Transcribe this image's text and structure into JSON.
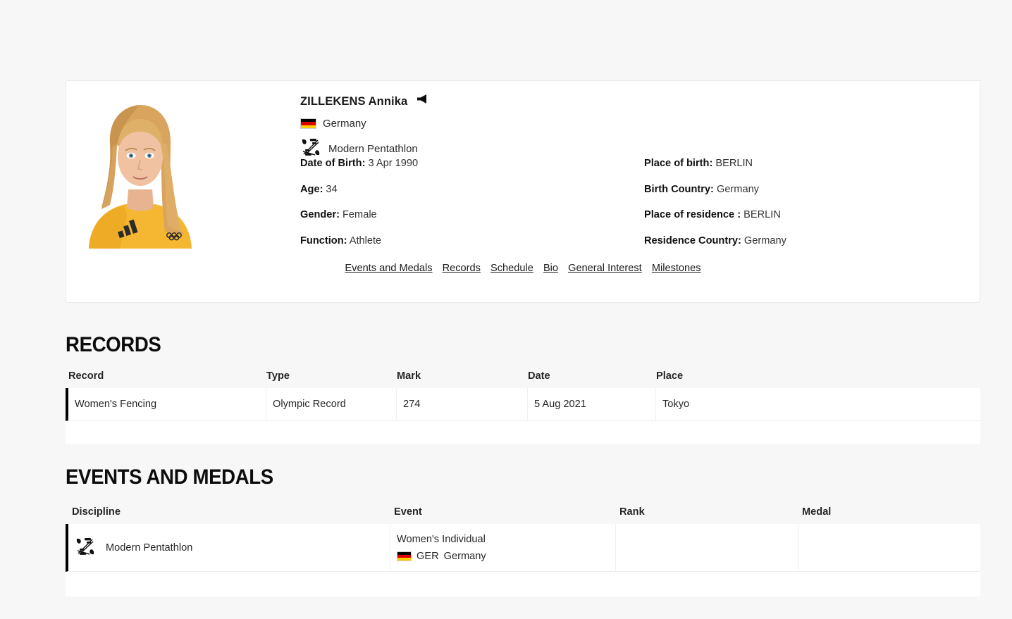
{
  "athlete": {
    "name": "ZILLEKENS Annika",
    "audio_icon": "speaker-icon",
    "country": "Germany",
    "country_flag": "germany-flag-icon",
    "sport": "Modern Pentathlon",
    "sport_icon": "modern-pentathlon-icon",
    "photo_alt": "athlete-portrait",
    "details_left": [
      {
        "label": "Date of Birth:",
        "value": "3 Apr 1990"
      },
      {
        "label": "Age:",
        "value": "34"
      },
      {
        "label": "Gender:",
        "value": "Female"
      },
      {
        "label": "Function:",
        "value": "Athlete"
      }
    ],
    "details_right": [
      {
        "label": "Place of birth:",
        "value": "BERLIN"
      },
      {
        "label": "Birth Country:",
        "value": "Germany"
      },
      {
        "label": "Place of residence :",
        "value": "BERLIN"
      },
      {
        "label": "Residence Country:",
        "value": "Germany"
      }
    ],
    "nav_links": [
      "Events and Medals",
      "Records",
      "Schedule",
      "Bio",
      "General Interest",
      "Milestones"
    ]
  },
  "records_section": {
    "title": "RECORDS",
    "columns": [
      "Record",
      "Type",
      "Mark",
      "Date",
      "Place"
    ],
    "rows": [
      {
        "record": "Women's Fencing",
        "type": "Olympic Record",
        "mark": "274",
        "date": "5 Aug 2021",
        "place": "Tokyo"
      }
    ]
  },
  "events_section": {
    "title": "EVENTS AND MEDALS",
    "columns": [
      "Discipline",
      "Event",
      "Rank",
      "Medal"
    ],
    "rows": [
      {
        "discipline": "Modern Pentathlon",
        "discipline_icon": "modern-pentathlon-icon",
        "event_name": "Women's Individual",
        "event_country_code": "GER",
        "event_country": "Germany",
        "event_country_flag": "germany-flag-icon",
        "rank": "",
        "medal": ""
      }
    ]
  },
  "colors": {
    "page_background": "#f7f7f7",
    "card_background": "#ffffff",
    "row_accent": "#000000",
    "text": "#1a1a1a",
    "flag_black": "#000000",
    "flag_red": "#dd0000",
    "flag_gold": "#ffce00"
  }
}
